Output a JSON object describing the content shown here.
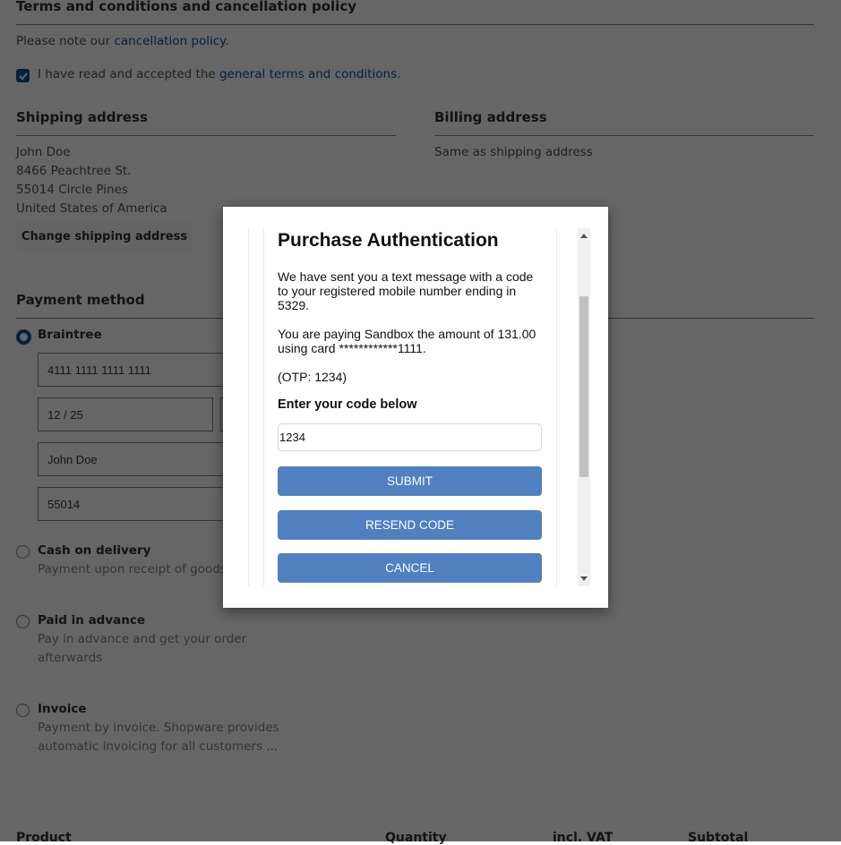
{
  "terms": {
    "title": "Terms and conditions and cancellation policy",
    "note_prefix": "Please note our ",
    "note_link": "cancellation policy",
    "note_suffix": ".",
    "accept_prefix": "I have read and accepted the ",
    "accept_link": "general terms and conditions",
    "accept_suffix": ".",
    "accepted": true
  },
  "shipping": {
    "title": "Shipping address",
    "lines": [
      "John Doe",
      "8466 Peachtree St.",
      "55014 Circle Pines",
      "United States of America"
    ],
    "change_button": "Change shipping address"
  },
  "billing": {
    "title": "Billing address",
    "text": "Same as shipping address"
  },
  "payment": {
    "title": "Payment method",
    "selected": "Braintree",
    "braintree": {
      "label": "Braintree",
      "card_number": "4111 1111 1111 1111",
      "expiry": "12 / 25",
      "cardholder": "John Doe",
      "postal_code": "55014"
    },
    "methods": [
      {
        "label": "Cash on delivery",
        "desc": "Payment upon receipt of goods."
      },
      {
        "label": "Paid in advance",
        "desc": "Pay in advance and get your order afterwards"
      },
      {
        "label": "Invoice",
        "desc": "Payment by invoice. Shopware provides automatic invoicing for all customers ..."
      }
    ]
  },
  "table_headers": [
    "Product",
    "Quantity",
    "incl. VAT",
    "Subtotal"
  ],
  "modal": {
    "title": "Purchase Authentication",
    "message1": "We have sent you a text message with a code to your registered mobile number ending in 5329.",
    "message2": "You are paying Sandbox the amount of 131.00 using card ************1111.",
    "otp_hint": "(OTP: 1234)",
    "code_label": "Enter your code below",
    "code_value": "1234",
    "submit": "SUBMIT",
    "resend": "RESEND CODE",
    "cancel": "CANCEL"
  }
}
